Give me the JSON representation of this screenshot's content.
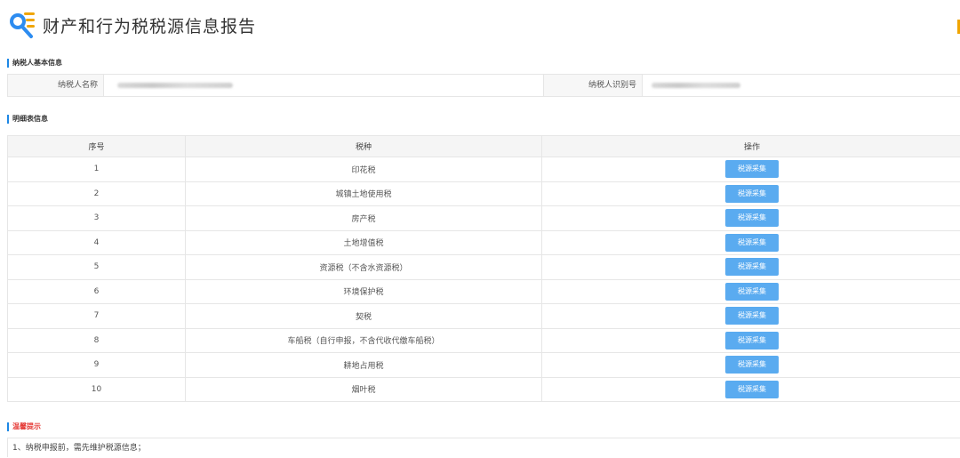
{
  "header": {
    "title": "财产和行为税税源信息报告"
  },
  "taxpayer": {
    "section_title": "纳税人基本信息",
    "name_label": "纳税人名称",
    "id_label": "纳税人识别号"
  },
  "detail": {
    "section_title": "明细表信息",
    "columns": [
      "序号",
      "税种",
      "操作"
    ],
    "button_label": "税源采集",
    "rows": [
      {
        "no": "1",
        "tax": "印花税"
      },
      {
        "no": "2",
        "tax": "城镇土地使用税"
      },
      {
        "no": "3",
        "tax": "房产税"
      },
      {
        "no": "4",
        "tax": "土地增值税"
      },
      {
        "no": "5",
        "tax": "资源税（不含水资源税）"
      },
      {
        "no": "6",
        "tax": "环境保护税"
      },
      {
        "no": "7",
        "tax": "契税"
      },
      {
        "no": "8",
        "tax": "车船税（自行申报，不含代收代缴车船税）"
      },
      {
        "no": "9",
        "tax": "耕地占用税"
      },
      {
        "no": "10",
        "tax": "烟叶税"
      }
    ]
  },
  "tips": {
    "section_title": "温馨提示",
    "items": [
      "1、纳税申报前，需先维护税源信息；"
    ]
  },
  "colors": {
    "accent": "#1e88e5",
    "button": "#5aabf0",
    "warning": "#e53935",
    "marker": "#f0a500"
  }
}
